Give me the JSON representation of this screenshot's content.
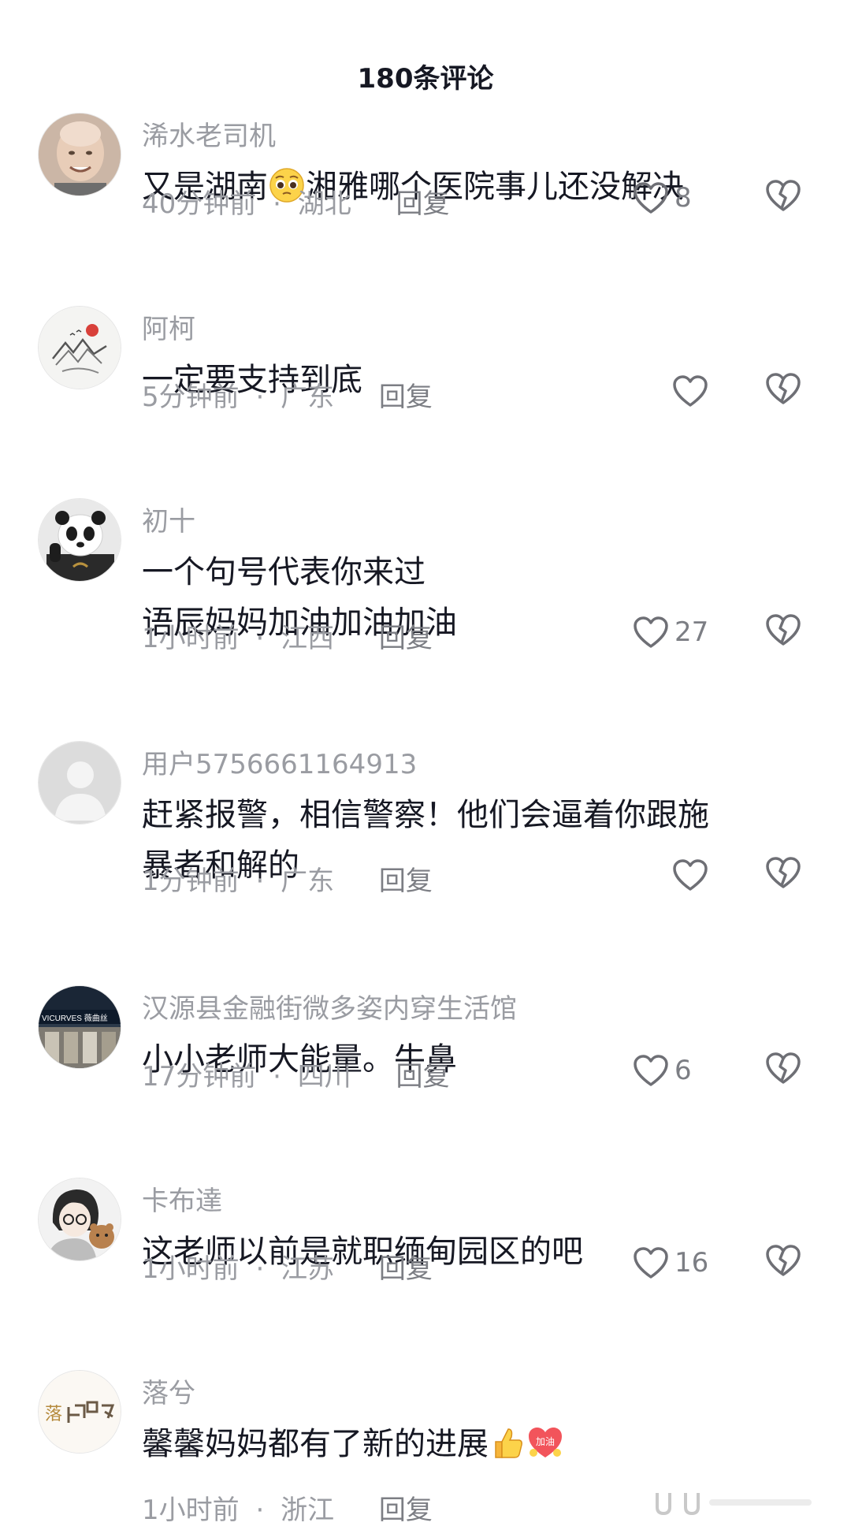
{
  "header": {
    "title": "180条评论"
  },
  "comments": [
    {
      "avatar": "bald-man-avatar",
      "username": "浠水老司机",
      "text_before": "又是湖南",
      "emoji": "pleading-face",
      "text_after": "湘雅哪个医院事儿还没解决",
      "time": "40分钟前",
      "location": "湖北",
      "reply": "回复",
      "likes": "8"
    },
    {
      "avatar": "landscape-painting-avatar",
      "username": "阿柯",
      "text": "一定要支持到底",
      "time": "5分钟前",
      "location": "广东",
      "reply": "回复",
      "likes": ""
    },
    {
      "avatar": "panda-avatar",
      "username": "初十",
      "text_line1": "一个句号代表你来过",
      "text_line2": "语辰妈妈加油加油加油",
      "time": "1小时前",
      "location": "江西",
      "reply": "回复",
      "likes": "27"
    },
    {
      "avatar": "default-user-avatar",
      "username": "用户5756661164913",
      "text_line1": "赶紧报警，相信警察！他们会逼着你跟施",
      "text_line2": "暴者和解的",
      "time": "1分钟前",
      "location": "广东",
      "reply": "回复",
      "likes": ""
    },
    {
      "avatar": "storefront-avatar",
      "avatar_sign": "VICURVES 薇曲丝",
      "username": "汉源县金融街微多姿内穿生活馆",
      "text": "小小老师大能量。牛鼻",
      "time": "17分钟前",
      "location": "四川",
      "reply": "回复",
      "likes": "6"
    },
    {
      "avatar": "cartoon-boy-avatar",
      "username": "卡布達",
      "text": "这老师以前是就职缅甸园区的吧",
      "time": "1小时前",
      "location": "江苏",
      "reply": "回复",
      "likes": "16"
    },
    {
      "avatar": "calligraphy-avatar",
      "avatar_text": "落",
      "username": "落兮",
      "text": "馨馨妈妈都有了新的进展",
      "emoji1": "thumbs-up",
      "emoji2": "jiayou-heart",
      "emoji2_text": "加油",
      "time": "1小时前",
      "location": "浙江",
      "reply": "回复",
      "likes": ""
    }
  ],
  "separator": "·"
}
